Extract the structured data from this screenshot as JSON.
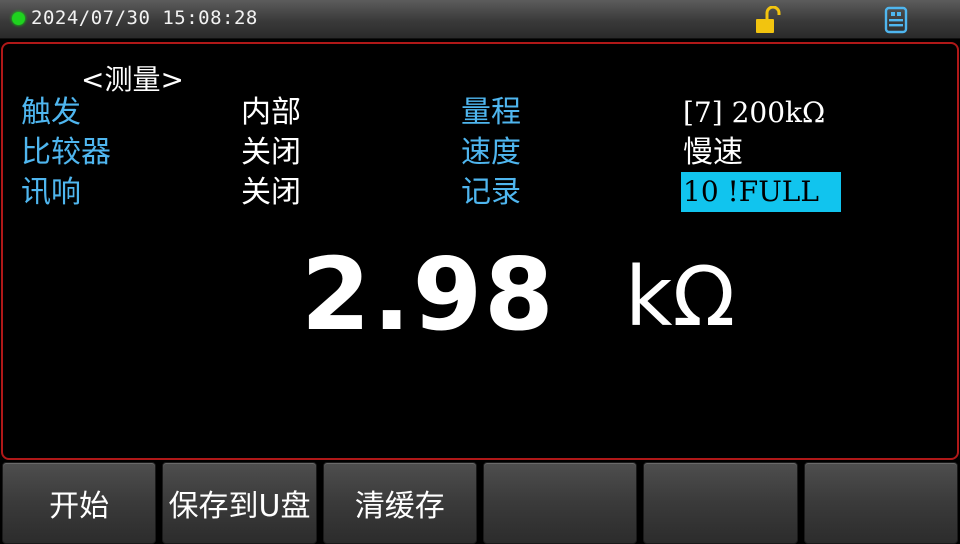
{
  "status": {
    "datetime": "2024/07/30  15:08:28",
    "icons": [
      "status-dot",
      "unlocked-lock-icon",
      "usb-icon"
    ],
    "colors": {
      "dot": "#1fd31f",
      "lock": "#f2c40f",
      "usb": "#4fb6ef"
    }
  },
  "page": {
    "title": "<测量>"
  },
  "params": {
    "trigger": {
      "label": "触发",
      "value": "内部"
    },
    "range": {
      "label": "量程",
      "value": "[7] 200kΩ"
    },
    "comparator": {
      "label": "比较器",
      "value": "关闭"
    },
    "speed": {
      "label": "速度",
      "value": "慢速"
    },
    "beep": {
      "label": "讯响",
      "value": "关闭"
    },
    "record": {
      "label": "记录",
      "value": "10 !FULL"
    }
  },
  "measurement": {
    "value": "2.98",
    "unit": "kΩ"
  },
  "softkeys": [
    "开始",
    "保存到U盘",
    "清缓存",
    "",
    "",
    ""
  ],
  "colors": {
    "label": "#4fb6ef",
    "highlight": "#11c4ee",
    "frame": "#b01818"
  }
}
